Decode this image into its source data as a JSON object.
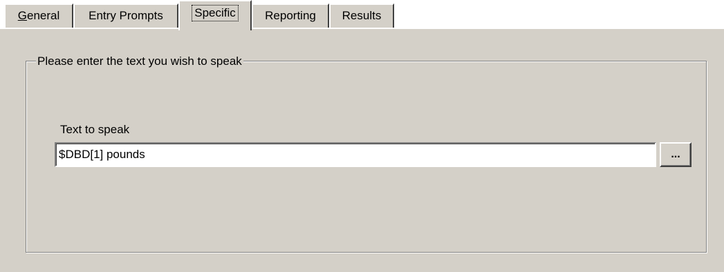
{
  "tabs": [
    {
      "label_accel": "G",
      "label_rest": "eneral",
      "selected": false
    },
    {
      "label": "Entry Prompts",
      "selected": false
    },
    {
      "label": "Specific",
      "selected": true
    },
    {
      "label": "Reporting",
      "selected": false
    },
    {
      "label": "Results",
      "selected": false
    }
  ],
  "group": {
    "label": "Please enter the text you wish to speak"
  },
  "field": {
    "label": "Text to speak",
    "value": "$DBD[1] pounds"
  },
  "browse_button": {
    "label": "..."
  }
}
